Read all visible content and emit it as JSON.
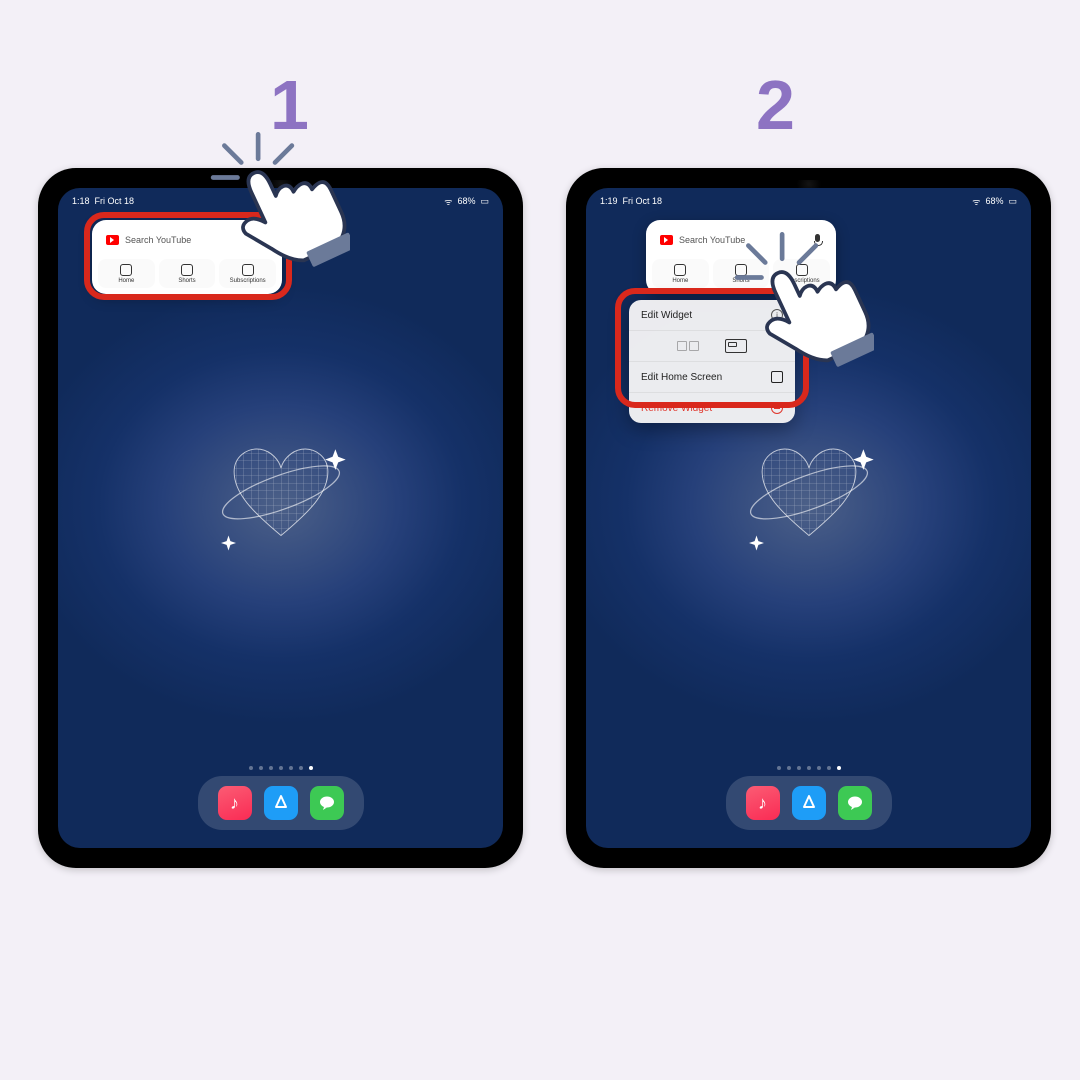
{
  "steps": {
    "one": "1",
    "two": "2"
  },
  "status": {
    "time1": "1:18",
    "time2": "1:19",
    "date": "Fri Oct 18",
    "battery": "68%"
  },
  "widget": {
    "search_placeholder": "Search YouTube",
    "tiles": {
      "home": "Home",
      "shorts": "Shorts",
      "subs": "Subscriptions"
    }
  },
  "menu": {
    "edit_widget": "Edit Widget",
    "edit_home": "Edit Home Screen",
    "remove": "Remove Widget"
  },
  "dock": {
    "music": "♫",
    "store": "A",
    "msg": "✉"
  }
}
